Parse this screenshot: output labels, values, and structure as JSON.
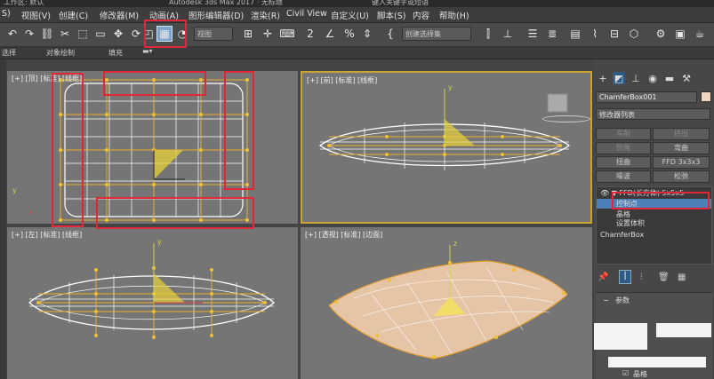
{
  "title_bar": {
    "left": "工作区: 默认",
    "center": "Autodesk 3ds Max 2017  ·  无标题",
    "search": "键入关键字或短语"
  },
  "menu": [
    "S)",
    "视图(V)",
    "创建(C)",
    "修改器(M)",
    "动画(A)",
    "图形编辑器(D)",
    "渲染(R)",
    "Civil View",
    "自定义(U)",
    "脚本(S)",
    "内容",
    "帮助(H)"
  ],
  "toolbar": {
    "view_dropdown": "视图",
    "selection_set": "创建选择集"
  },
  "ribbon": {
    "left": "选择",
    "middle1": "对象绘制",
    "middle2": "填充"
  },
  "viewports": {
    "top_left": "[+] [顶] [标准] [线框]",
    "top_right": "[+] [前] [标准] [线框]",
    "bottom_left": "[+] [左] [标准] [线框]",
    "bottom_right": "[+] [透视] [标准] [边面]"
  },
  "axis": {
    "x": "x",
    "y": "y",
    "z": "z"
  },
  "panel": {
    "object_name": "ChamferBox001",
    "modifier_list": "修改器列表",
    "buttons": [
      [
        "车削",
        "挤出"
      ],
      [
        "倒角",
        "弯曲"
      ],
      [
        "扭曲",
        "FFD 3x3x3"
      ],
      [
        "噪波",
        "松弛"
      ]
    ],
    "stack": {
      "ffd": "FFD(长方体) 5x5x5",
      "control_points": "控制点",
      "lattice": "晶格",
      "set_volume": "设置体积",
      "base": "ChamferBox"
    },
    "rollout": "参数",
    "checkbox_label": "晶格"
  },
  "colors": {
    "highlight": "#e0283a",
    "active_viewport": "#c8a532",
    "selected_row": "#4d7fb8"
  }
}
